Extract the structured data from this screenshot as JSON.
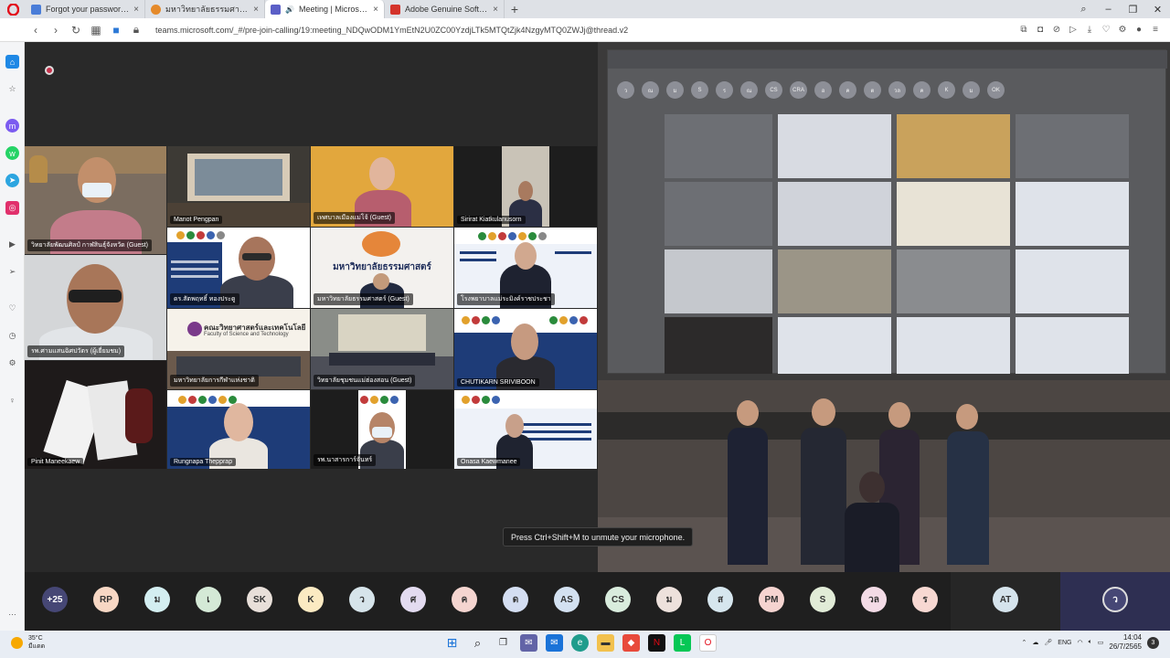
{
  "browser": {
    "tabs": [
      {
        "title": "Forgot your password? - Z",
        "favicon_color": "#4a7dd8"
      },
      {
        "title": "มหาวิทยาลัยธรรมศาสตร์",
        "favicon_color": "#e58a2b"
      },
      {
        "title": "Meeting | Microsoft Tea",
        "favicon_color": "#5b5fc7",
        "active": true
      },
      {
        "title": "Adobe Genuine Software",
        "favicon_color": "#d4332b"
      }
    ],
    "new_tab_label": "+",
    "url": "teams.microsoft.com/_#/pre-join-calling/19:meeting_NDQwODM1YmEtN2U0ZC00YzdjLTk5MTQtZjk4NzgyMTQ0ZWJj@thread.v2"
  },
  "meeting": {
    "tiles": [
      {
        "name": "วิทยาลัยพัฒนศิลป์ กาฬสินธุ์จังหวัด (Guest)"
      },
      {
        "name": "Manot Pengpan"
      },
      {
        "name": "เทศบาลเมืองแม่โจ้ (Guest)"
      },
      {
        "name": "Sirirat Kiatkulanusorn"
      },
      {
        "name": "ดร.สัตพฤทธิ์ ทองประดู"
      },
      {
        "name": "มหาวิทยาลัยธรรมศาสตร์ (Guest)"
      },
      {
        "name": "โรงพยาบาลแม่ระมิงค์ราชประชา"
      },
      {
        "name": "รพ.ศามแสนฉิศปวัตร (ผู้เยี่ยมชม)"
      },
      {
        "name": "มหาวิทยาลัยการกีฬาแห่งชาติ"
      },
      {
        "name": "วิทยาลัยชุมชนแม่ฮ่องสอน (Guest)"
      },
      {
        "name": "CHUTIKARN SRIVIBOON"
      },
      {
        "name": "Pinit Maneekaew"
      },
      {
        "name": "Rungnapa Thepprap"
      },
      {
        "name": "รพ.นาสารการ์จันทร์"
      },
      {
        "name": "Onasa Kaewmanee"
      }
    ],
    "slide_university_title": "มหาวิทยาลัยธรรมศาสตร์",
    "slide_faculty_title": "คณะวิทยาศาสตร์และเทคโนโลยี",
    "slide_faculty_subtitle": "Faculty of Science and Technology",
    "room_screen_avatars": [
      "ว",
      "ณ",
      "ม",
      "S",
      "ร",
      "ณ",
      "CS",
      "CRA",
      "อ",
      "ค",
      "ต",
      "วล",
      "ค",
      "K",
      "ม",
      "OK"
    ],
    "toast": "Press Ctrl+Shift+M to unmute your microphone."
  },
  "participants": [
    {
      "initials": "+25",
      "color": "#464775"
    },
    {
      "initials": "RP",
      "color": "#f7d7c4"
    },
    {
      "initials": "ม",
      "color": "#d3eef1"
    },
    {
      "initials": "เ",
      "color": "#d4e9d6"
    },
    {
      "initials": "SK",
      "color": "#e8dfd9"
    },
    {
      "initials": "K",
      "color": "#fbeac2"
    },
    {
      "initials": "ว",
      "color": "#d6e4ea"
    },
    {
      "initials": "ศ",
      "color": "#e3dbf0"
    },
    {
      "initials": "ค",
      "color": "#f5d5d0"
    },
    {
      "initials": "ด",
      "color": "#d4def2"
    },
    {
      "initials": "AS",
      "color": "#d3e1f1"
    },
    {
      "initials": "CS",
      "color": "#d9ecdd"
    },
    {
      "initials": "ม",
      "color": "#ede1dc"
    },
    {
      "initials": "ส",
      "color": "#d6e6ee"
    },
    {
      "initials": "PM",
      "color": "#f5d4d0"
    },
    {
      "initials": "S",
      "color": "#e1ecd7"
    },
    {
      "initials": "วล",
      "color": "#f3dbe6"
    },
    {
      "initials": "ร",
      "color": "#f7d8d2"
    }
  ],
  "participant_at": "AT",
  "participant_me": "ว",
  "taskbar": {
    "weather_temp": "35°C",
    "weather_desc": "มีแดด",
    "language": "ENG",
    "time": "14:04",
    "date": "26/7/2565",
    "notifications": "3"
  }
}
